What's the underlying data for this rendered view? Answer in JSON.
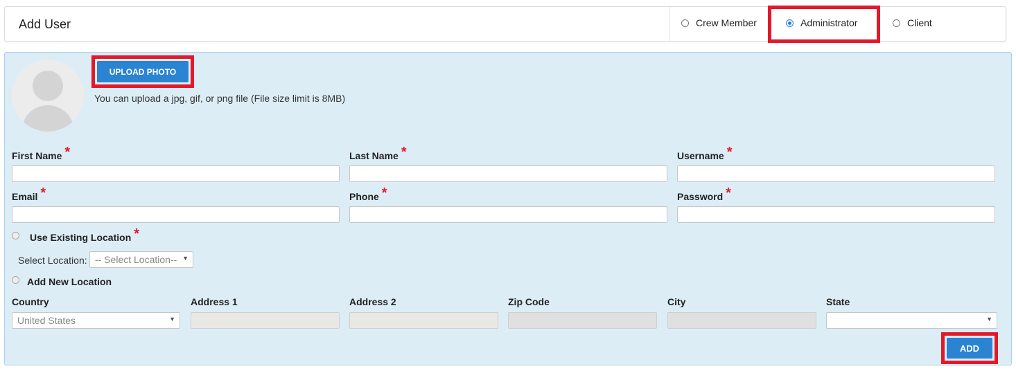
{
  "header": {
    "title": "Add User",
    "roles": [
      {
        "label": "Crew Member",
        "selected": false
      },
      {
        "label": "Administrator",
        "selected": true
      },
      {
        "label": "Client",
        "selected": false
      }
    ]
  },
  "photo": {
    "upload_label": "UPLOAD PHOTO",
    "hint": "You can upload a jpg, gif, or png file (File size limit is 8MB)"
  },
  "fields": {
    "first_name": "First Name",
    "last_name": "Last Name",
    "username": "Username",
    "email": "Email",
    "phone": "Phone",
    "password": "Password",
    "required_mark": "*"
  },
  "location": {
    "use_existing": "Use Existing Location",
    "select_label": "Select Location:",
    "select_value": "-- Select Location--",
    "add_new": "Add New Location",
    "country": "Country",
    "country_value": "United States",
    "address1": "Address 1",
    "address2": "Address 2",
    "zip": "Zip Code",
    "city": "City",
    "state": "State",
    "state_value": ""
  },
  "actions": {
    "add_label": "ADD"
  },
  "colors": {
    "accent": "#2a84d2",
    "highlight": "#e3192b",
    "panel_bg": "#dcedf6"
  }
}
